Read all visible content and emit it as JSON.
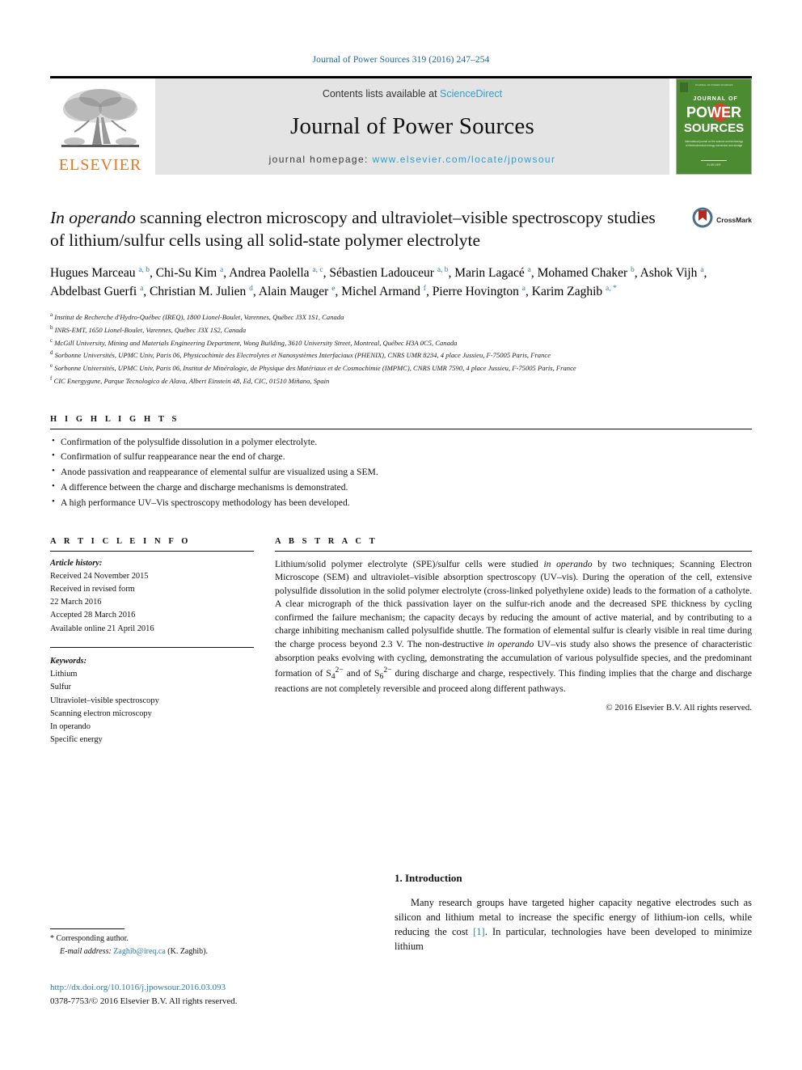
{
  "running_head": "Journal of Power Sources 319 (2016) 247–254",
  "masthead": {
    "publisher_name": "ELSEVIER",
    "contents_prefix": "Contents lists available at ",
    "contents_link": "ScienceDirect",
    "journal_title": "Journal of Power Sources",
    "homepage_prefix": "journal homepage: ",
    "homepage_url": "www.elsevier.com/locate/jpowsour",
    "cover": {
      "line1": "JOURNAL OF",
      "line2": "POWER",
      "line3": "SOURCES",
      "blurb": "International journal on the science and technology of electrochemical energy conversion and storage",
      "brand": "ELSEVIER"
    }
  },
  "article": {
    "title_part1_italic": "In operando",
    "title_rest": " scanning electron microscopy and ultraviolet–visible spectroscopy studies of lithium/sulfur cells using all solid-state polymer electrolyte",
    "crossmark_label": "CrossMark",
    "authors_html": "Hugues Marceau <sup>a, b</sup>, Chi-Su Kim <sup>a</sup>, Andrea Paolella <sup>a, c</sup>, Sébastien Ladouceur <sup>a, b</sup>, Marin Lagacé <sup>a</sup>, Mohamed Chaker <sup>b</sup>, Ashok Vijh <sup>a</sup>, Abdelbast Guerfi <sup>a</sup>, Christian M. Julien <sup>d</sup>, Alain Mauger <sup>e</sup>, Michel Armand <sup>f</sup>, Pierre Hovington <sup>a</sup>, Karim Zaghib <sup>a, *</sup>",
    "affiliations": [
      {
        "marker": "a",
        "text": "Institut de Recherche d'Hydro-Québec (IREQ), 1800 Lionel-Boulet, Varennes, Québec J3X 1S1, Canada"
      },
      {
        "marker": "b",
        "text": "INRS-EMT, 1650 Lionel-Boulet, Varennes, Québec J3X 1S2, Canada"
      },
      {
        "marker": "c",
        "text": "McGill University, Mining and Materials Engineering Department, Wong Building, 3610 University Street, Montreal, Québec H3A 0C5, Canada"
      },
      {
        "marker": "d",
        "text": "Sorbonne Universités, UPMC Univ, Paris 06, Physicochimie des Electrolytes et Nanosystèmes Interfaciaux (PHENIX), CNRS UMR 8234, 4 place Jussieu, F-75005 Paris, France"
      },
      {
        "marker": "e",
        "text": "Sorbonne Universités, UPMC Univ, Paris 06, Institut de Minéralogie, de Physique des Matériaux et de Cosmochimie (IMPMC), CNRS UMR 7590, 4 place Jussieu, F-75005 Paris, France"
      },
      {
        "marker": "f",
        "text": "CIC Energygune, Parque Tecnologico de Alava, Albert Einstein 48, Ed, CIC, 01510 Miñano, Spain"
      }
    ]
  },
  "highlights": {
    "heading": "H I G H L I G H T S",
    "items": [
      "Confirmation of the polysulfide dissolution in a polymer electrolyte.",
      "Confirmation of sulfur reappearance near the end of charge.",
      "Anode passivation and reappearance of elemental sulfur are visualized using a SEM.",
      "A difference between the charge and discharge mechanisms is demonstrated.",
      "A high performance UV–Vis spectroscopy methodology has been developed."
    ]
  },
  "article_info": {
    "heading": "A R T I C L E   I N F O",
    "history_label": "Article history:",
    "history": [
      "Received 24 November 2015",
      "Received in revised form",
      "22 March 2016",
      "Accepted 28 March 2016",
      "Available online 21 April 2016"
    ],
    "keywords_label": "Keywords:",
    "keywords": [
      "Lithium",
      "Sulfur",
      "Ultraviolet–visible spectroscopy",
      "Scanning electron microscopy",
      "In operando",
      "Specific energy"
    ]
  },
  "abstract": {
    "heading": "A B S T R A C T",
    "paragraph_html": "Lithium/solid polymer electrolyte (SPE)/sulfur cells were studied <span class=\"it\">in operando</span> by two techniques; Scanning Electron Microscope (SEM) and ultraviolet–visible absorption spectroscopy (UV–vis). During the operation of the cell, extensive polysulfide dissolution in the solid polymer electrolyte (cross-linked polyethylene oxide) leads to the formation of a catholyte. A clear micrograph of the thick passivation layer on the sulfur-rich anode and the decreased SPE thickness by cycling confirmed the failure mechanism; the capacity decays by reducing the amount of active material, and by contributing to a charge inhibiting mechanism called polysulfide shuttle. The formation of elemental sulfur is clearly visible in real time during the charge process beyond 2.3 V. The non-destructive <span class=\"it\">in operando</span> UV–vis study also shows the presence of characteristic absorption peaks evolving with cycling, demonstrating the accumulation of various polysulfide species, and the predominant formation of S<sub>4</sub><sup>2−</sup> and of S<sub>6</sub><sup>2−</sup> during discharge and charge, respectively. This finding implies that the charge and discharge reactions are not completely reversible and proceed along different pathways.",
    "copyright": "© 2016 Elsevier B.V. All rights reserved."
  },
  "introduction": {
    "heading": "1. Introduction",
    "paragraph_html": "Many research groups have targeted higher capacity negative electrodes such as silicon and lithium metal to increase the specific energy of lithium-ion cells, while reducing the cost <span class=\"ref\">[1]</span>. In particular, technologies have been developed to minimize lithium"
  },
  "footer": {
    "corresponding_marker": "*",
    "corresponding_label": "Corresponding author.",
    "email_label": "E-mail address:",
    "email": "Zaghib@ireq.ca",
    "email_suffix": "(K. Zaghib).",
    "doi_url": "http://dx.doi.org/10.1016/j.jpowsour.2016.03.093",
    "issn_line": "0378-7753/© 2016 Elsevier B.V. All rights reserved."
  },
  "colors": {
    "link_blue": "#2a7ab0",
    "sciencedirect_blue": "#2a9fd0",
    "elsevier_orange": "#E87722",
    "cover_green": "#4d8b32",
    "masthead_grey": "#e4e4e4"
  }
}
